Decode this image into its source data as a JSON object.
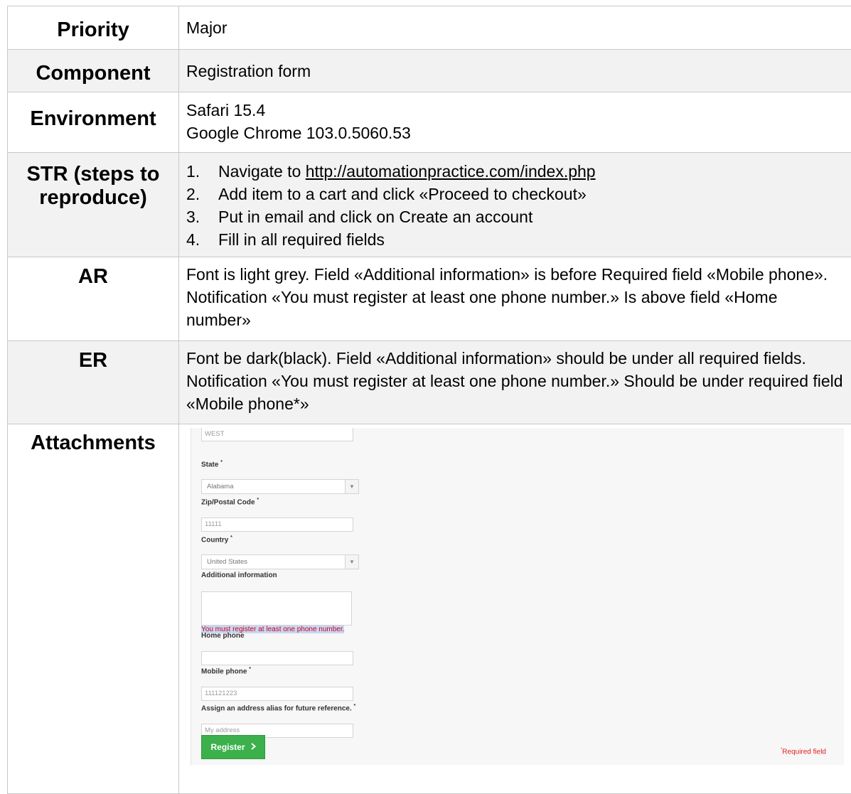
{
  "rows": {
    "priority": {
      "label": "Priority",
      "value": "Major"
    },
    "component": {
      "label": "Component",
      "value": "Registration form"
    },
    "environment": {
      "label": "Environment",
      "lines": [
        "Safari 15.4",
        "Google Chrome 103.0.5060.53"
      ]
    },
    "str": {
      "label": "STR (steps to reproduce)",
      "steps": [
        {
          "num": "1.",
          "text": "Navigate to ",
          "link": "http://automationpractice.com/index.php"
        },
        {
          "num": "2.",
          "text": "Add item to a cart and click «Proceed to checkout»"
        },
        {
          "num": "3.",
          "text": "Put in email and click on Create an account"
        },
        {
          "num": "4.",
          "text": "Fill in all required fields"
        }
      ]
    },
    "ar": {
      "label": "AR",
      "value": "Font is light grey. Field «Additional information» is before Required field «Mobile phone». Notification «You must register at least one phone number.» Is above field «Home number»"
    },
    "er": {
      "label": "ER",
      "value": "Font be dark(black). Field «Additional information» should be under all required fields. Notification «You must register at least one phone number.» Should be under required field «Mobile phone*»"
    },
    "attachments": {
      "label": "Attachments"
    }
  },
  "attachment_form": {
    "city_value": "WEST",
    "state_label": "State",
    "state_value": "Alabama",
    "zip_label": "Zip/Postal Code",
    "zip_value": "11111",
    "country_label": "Country",
    "country_value": "United States",
    "additional_label": "Additional information",
    "error_text": "You must register at least one phone number.",
    "home_phone_label": "Home phone",
    "mobile_phone_label": "Mobile phone",
    "mobile_phone_value": "111121223",
    "alias_label": "Assign an address alias for future reference.",
    "alias_value": "My address",
    "register_label": "Register",
    "required_note": "Required field",
    "asterisk": "*"
  },
  "colors": {
    "grey_row": "#f2f2f2",
    "register_green": "#3bb04b",
    "error_red": "#d0021b"
  }
}
